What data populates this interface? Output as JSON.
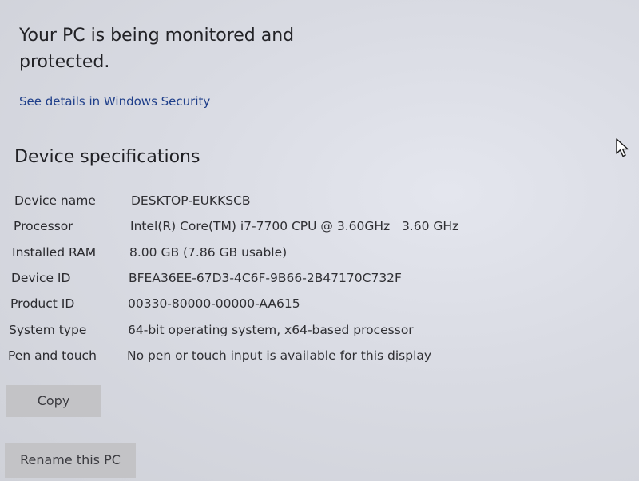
{
  "protection": {
    "title": "Your PC is being monitored and protected.",
    "link": "See details in Windows Security"
  },
  "device_specs": {
    "title": "Device specifications",
    "rows": [
      {
        "label": "Device name",
        "value": "DESKTOP-EUKKSCB"
      },
      {
        "label": "Processor",
        "value": "Intel(R) Core(TM) i7-7700 CPU @ 3.60GHz   3.60 GHz"
      },
      {
        "label": "Installed RAM",
        "value": "8.00 GB (7.86 GB usable)"
      },
      {
        "label": "Device ID",
        "value": "BFEA36EE-67D3-4C6F-9B66-2B47170C732F"
      },
      {
        "label": "Product ID",
        "value": "00330-80000-00000-AA615"
      },
      {
        "label": "System type",
        "value": "64-bit operating system, x64-based processor"
      },
      {
        "label": "Pen and touch",
        "value": "No pen or touch input is available for this display"
      }
    ]
  },
  "buttons": {
    "copy": "Copy",
    "rename": "Rename this PC"
  },
  "cursor": {
    "icon": "mouse-pointer-icon"
  }
}
